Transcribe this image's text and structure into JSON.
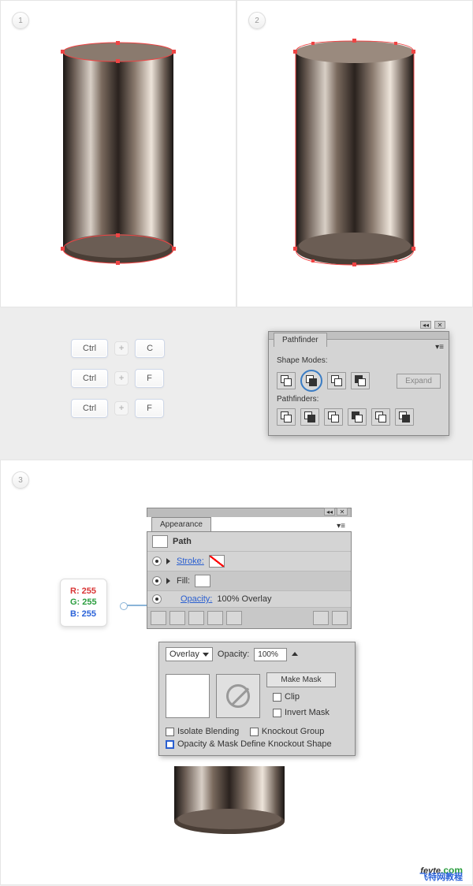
{
  "steps": {
    "s1": "1",
    "s2": "2",
    "s3": "3"
  },
  "keys": {
    "ctrl": "Ctrl",
    "c": "C",
    "f": "F"
  },
  "pathfinder": {
    "title": "Pathfinder",
    "shapeModes": "Shape Modes:",
    "pathfinders": "Pathfinders:",
    "expand": "Expand"
  },
  "appearance": {
    "title": "Appearance",
    "path": "Path",
    "stroke": "Stroke:",
    "fill": "Fill:",
    "opacity": "Opacity:",
    "opacityVal": "100% Overlay"
  },
  "transparency": {
    "mode": "Overlay",
    "opacityLabel": "Opacity:",
    "opacityVal": "100%",
    "makeMask": "Make Mask",
    "clip": "Clip",
    "invertMask": "Invert Mask",
    "isolate": "Isolate Blending",
    "knockout": "Knockout Group",
    "define": "Opacity & Mask Define Knockout Shape"
  },
  "rgb": {
    "r": "R: 255",
    "g": "G: 255",
    "b": "B: 255"
  },
  "watermark": {
    "main": "fevte",
    "dom": ".com",
    "sub": "飞特网教程"
  }
}
